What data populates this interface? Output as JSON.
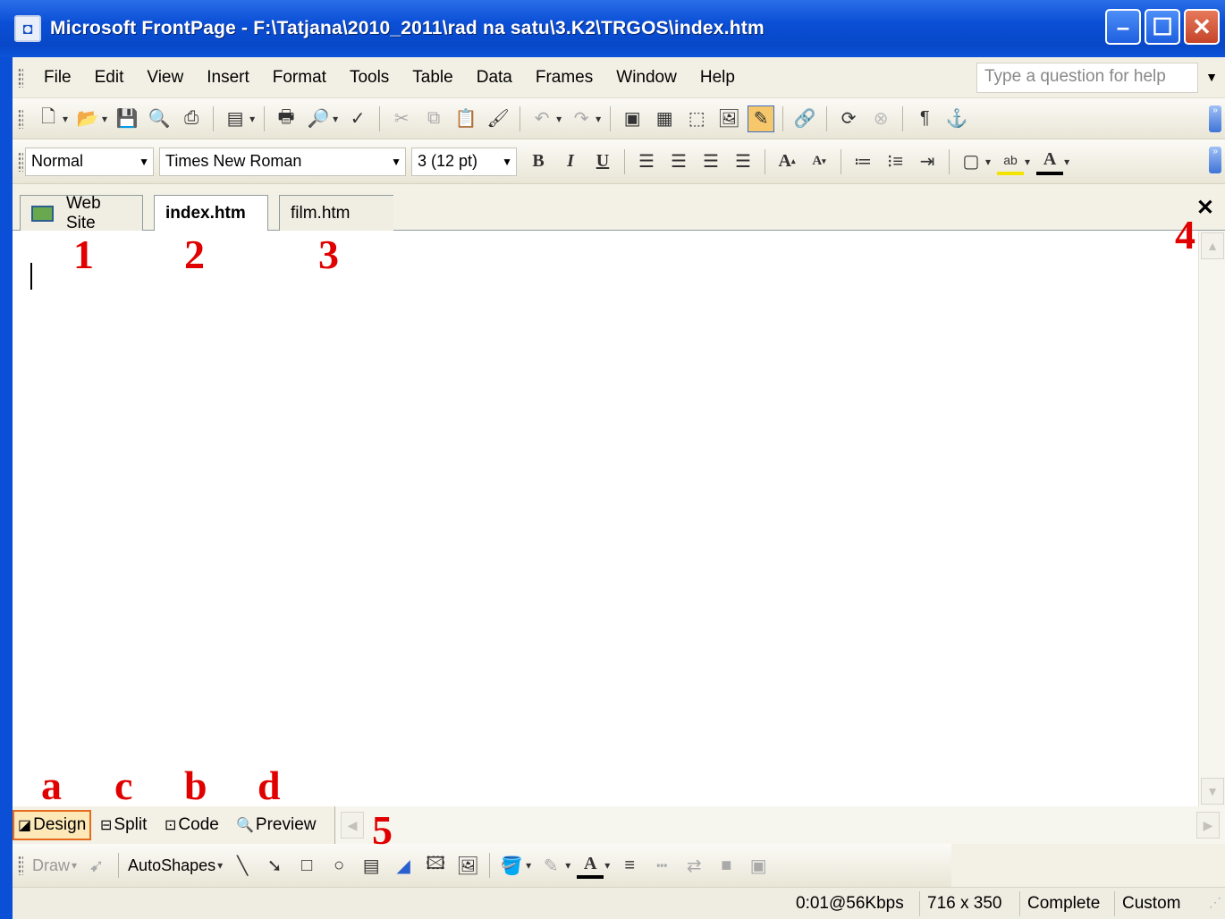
{
  "window": {
    "title": "Microsoft FrontPage - F:\\Tatjana\\2010_2011\\rad na satu\\3.K2\\TRGOS\\index.htm",
    "buttons": [
      "minimize",
      "maximize",
      "close"
    ]
  },
  "menu": {
    "items": [
      "File",
      "Edit",
      "View",
      "Insert",
      "Format",
      "Tools",
      "Table",
      "Data",
      "Frames",
      "Window",
      "Help"
    ],
    "help_placeholder": "Type a question for help"
  },
  "formatting": {
    "style": "Normal",
    "font": "Times New Roman",
    "size": "3 (12 pt)"
  },
  "tabs": [
    {
      "label": "Web Site",
      "active": false
    },
    {
      "label": "index.htm",
      "active": true
    },
    {
      "label": "film.htm",
      "active": false
    }
  ],
  "views": [
    {
      "label": "Design",
      "active": true
    },
    {
      "label": "Split",
      "active": false
    },
    {
      "label": "Code",
      "active": false
    },
    {
      "label": "Preview",
      "active": false
    }
  ],
  "drawing": {
    "draw_label": "Draw",
    "autoshapes_label": "AutoShapes"
  },
  "status": {
    "speed": "0:01@56Kbps",
    "dimensions": "716 x 350",
    "state": "Complete",
    "mode": "Custom"
  },
  "annotations": {
    "tab1": "1",
    "tab2": "2",
    "tab3": "3",
    "close": "4",
    "scroll": "5",
    "design": "a",
    "split": "c",
    "code": "b",
    "preview": "d"
  },
  "colors": {
    "titlebar": "#0a4fd6",
    "annotation": "#e00000",
    "active_view": "#e66a1c"
  }
}
